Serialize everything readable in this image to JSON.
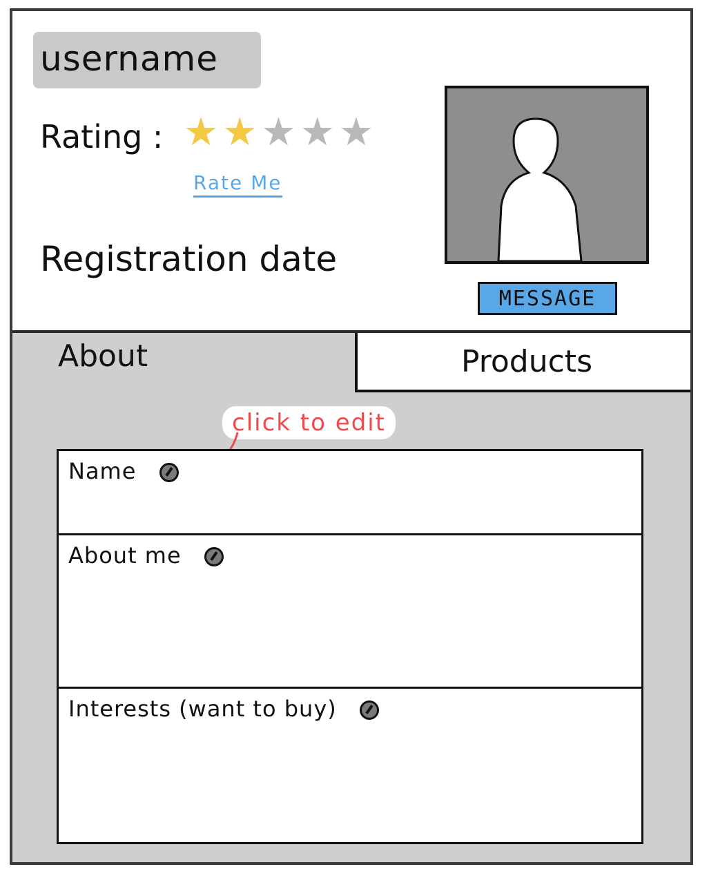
{
  "header": {
    "username": "username",
    "rating_label": "Rating :",
    "rating": {
      "value": 2,
      "max": 5,
      "filled_color": "#f5c842",
      "empty_color": "#b8b8b8"
    },
    "rate_link": "Rate Me",
    "registration_label": "Registration date",
    "avatar_icon": "user-silhouette-icon",
    "message_button": "MESSAGE"
  },
  "tabs": [
    {
      "label": "About",
      "active": true
    },
    {
      "label": "Products",
      "active": false
    }
  ],
  "hint": "click to edit",
  "fields": {
    "name": {
      "label": "Name",
      "icon": "edit-icon"
    },
    "about": {
      "label": "About me",
      "icon": "edit-icon"
    },
    "interests": {
      "label": "Interests (want to buy)",
      "icon": "edit-icon"
    }
  },
  "colors": {
    "accent_blue": "#5aa7e8",
    "hint_red": "#ef4b4f",
    "panel_gray": "#cfcfcf",
    "chip_gray": "#c9c9c9"
  }
}
